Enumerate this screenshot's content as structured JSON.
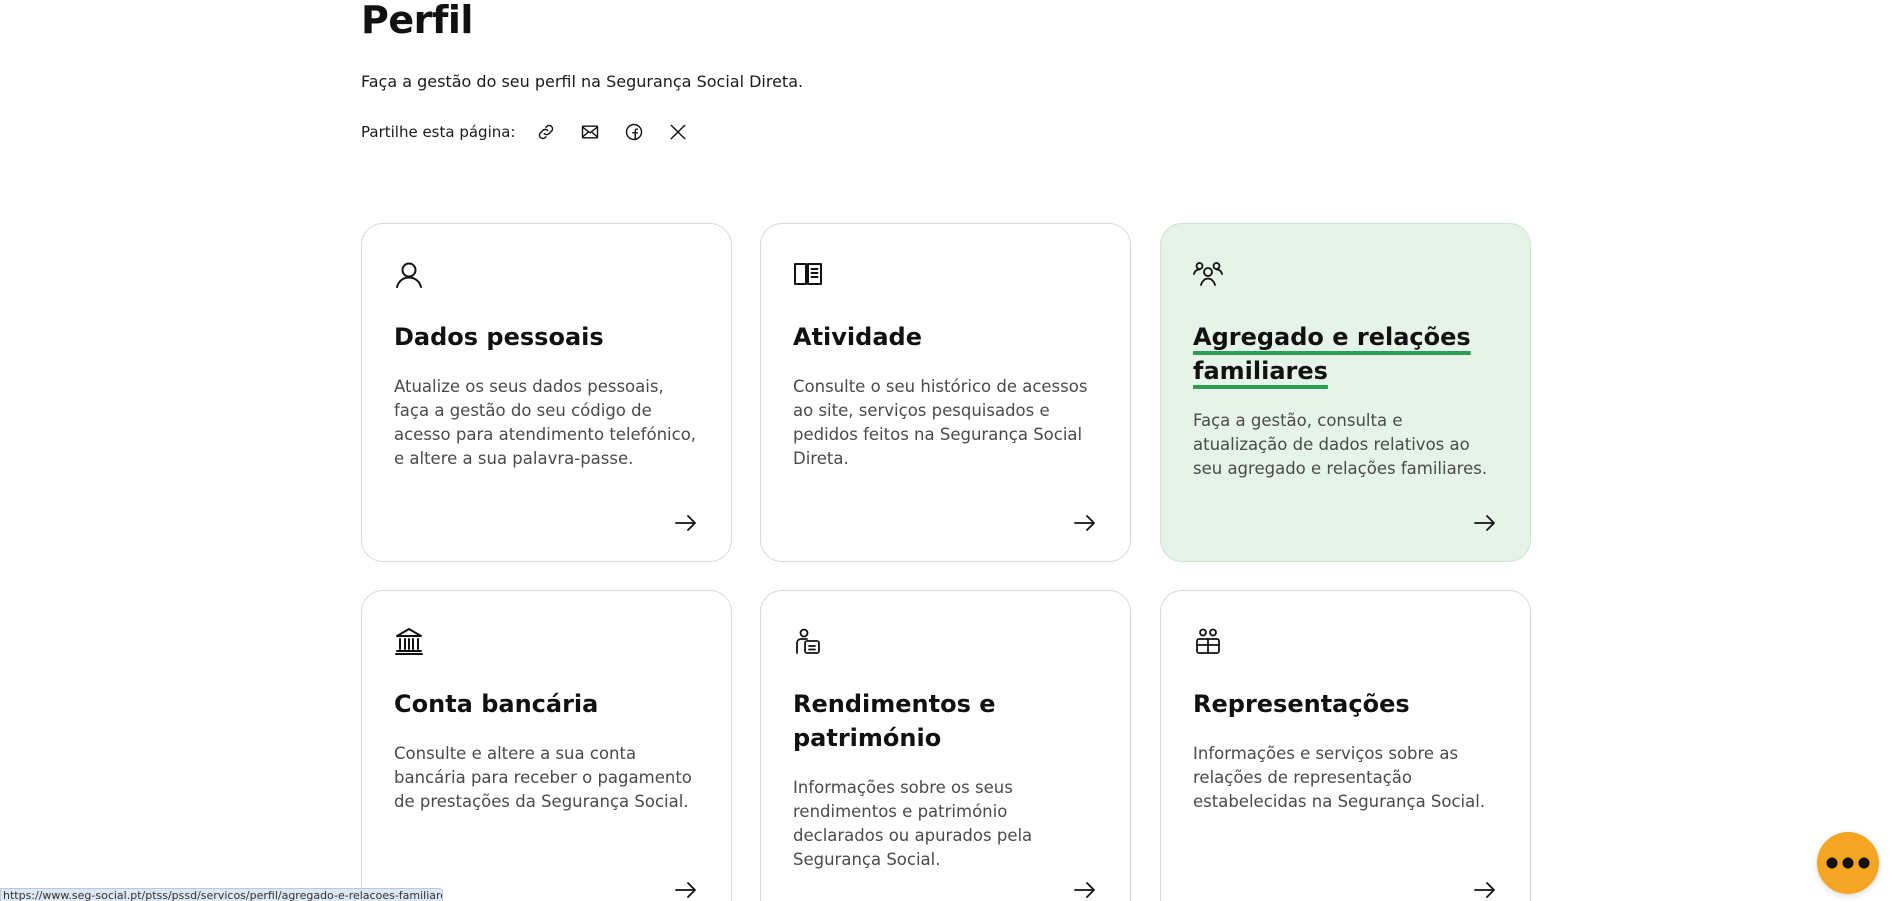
{
  "page": {
    "title": "Perfil",
    "subtitle": "Faça a gestão do seu perfil na Segurança Social Direta.",
    "share_label": "Partilhe esta página:"
  },
  "share_icons": [
    "link-icon",
    "mail-icon",
    "facebook-icon",
    "x-icon"
  ],
  "cards": [
    {
      "icon": "person-icon",
      "title": "Dados pessoais",
      "description": "Atualize os seus dados pessoais, faça a gestão do seu código de acesso para atendimento telefónico, e altere a sua palavra-passe."
    },
    {
      "icon": "book-icon",
      "title": "Atividade",
      "description": "Consulte o seu histórico de acessos ao site, serviços pesquisados e pedidos feitos na Segurança Social Direta."
    },
    {
      "icon": "group-icon",
      "title": "Agregado e relações familiares",
      "description": "Faça a gestão, consulta e atualização de dados relativos ao seu agregado e relações familiares.",
      "state": "hovered"
    },
    {
      "icon": "bank-icon",
      "title": "Conta bancária",
      "description": "Consulte e altere a sua conta bancária para receber o pagamento de prestações da Segurança Social."
    },
    {
      "icon": "income-icon",
      "title": "Rendimentos e património",
      "description": "Informações sobre os seus rendimentos e património declarados ou apurados pela Segurança Social."
    },
    {
      "icon": "representation-icon",
      "title": "Representações",
      "description": "Informações e serviços sobre as relações de representação estabelecidas na Segurança Social."
    }
  ],
  "status_bar": {
    "url": "https://www.seg-social.pt/ptss/pssd/servicos/perfil/agregado-e-relacoes-familiares"
  },
  "chat": {
    "icon": "chat-dots-icon"
  },
  "colors": {
    "accent_green": "#2e9e55",
    "active_card_bg": "#e6f3e8",
    "chat_orange": "#f5a524"
  }
}
